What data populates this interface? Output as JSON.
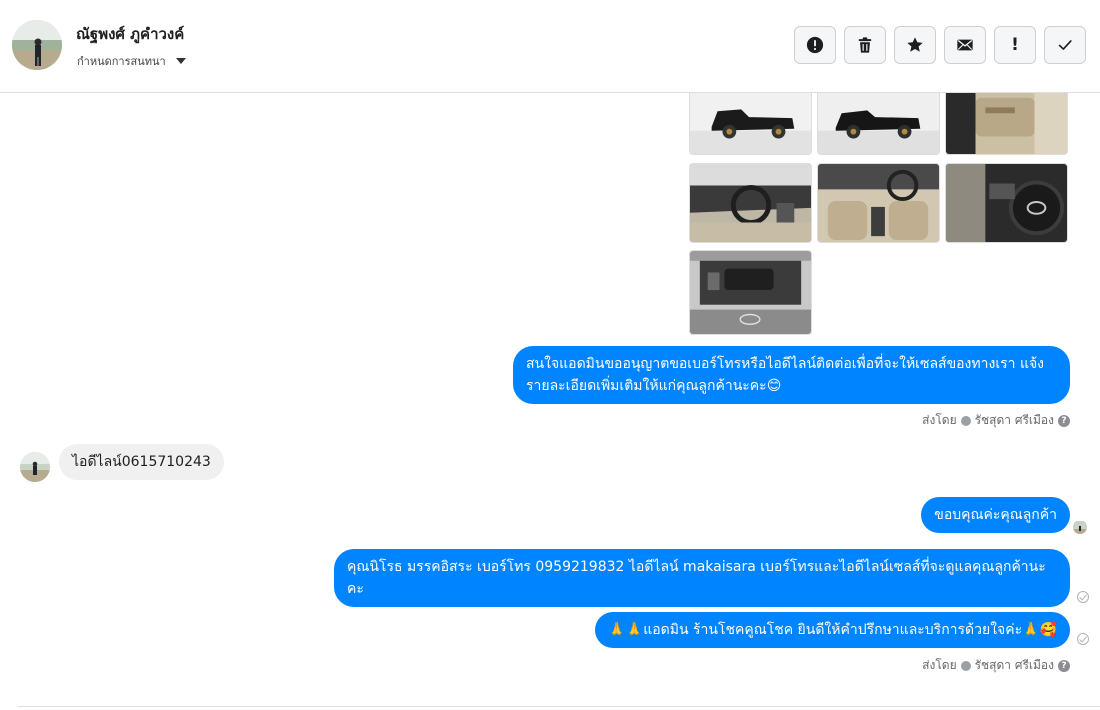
{
  "header": {
    "contact_name": "ณัฐพงศ์ ภูคำวงค์",
    "assign_label": "กำหนดการสนทนา",
    "actions": [
      {
        "name": "spam-button",
        "icon": "alert-circle-icon"
      },
      {
        "name": "delete-button",
        "icon": "trash-icon"
      },
      {
        "name": "star-button",
        "icon": "star-icon"
      },
      {
        "name": "mark-unread-button",
        "icon": "envelope-icon"
      },
      {
        "name": "follow-up-button",
        "icon": "exclamation-icon",
        "glyph": "!"
      },
      {
        "name": "mark-done-button",
        "icon": "checkmark-icon"
      }
    ]
  },
  "messages": {
    "admin_msg_1": "สนใจแอดมินขออนุญาตขอเบอร์โทรหรือไอดีไลน์ติดต่อเพื่อที่จะให้เซลส์ของทางเรา แจ้งรายละเอียดเพิ่มเติมให้แก่คุณลูกค้านะคะ😊",
    "sent_by_1": {
      "prefix": "ส่งโดย",
      "agent": "รัชสุดา ศรีเมือง",
      "help": "?"
    },
    "customer_msg": "ไอดีไลน์0615710243",
    "admin_msg_2": "ขอบคุณค่ะคุณลูกค้า",
    "admin_msg_3": "คุณนิโรธ มรรคอิสระ       เบอร์โทร 0959219832  ไอดีไลน์ makaisara   เบอร์โทรและไอดีไลน์เซลส์ที่จะดูแลคุณลูกค้านะคะ",
    "admin_msg_4": "🙏🙏แอดมิน ร้านโชคคูณโชค ยินดีให้คำปรึกษาและบริการด้วยใจค่ะ🙏🥰",
    "sent_by_2": {
      "prefix": "ส่งโดย",
      "agent": "รัชสุดา ศรีเมือง",
      "help": "?"
    }
  },
  "colors": {
    "bubble_out": "#0084ff",
    "bubble_in": "#f0f0f0",
    "border": "#dddfe2"
  },
  "photos": [
    {
      "name": "photo-truck-side-1",
      "subject": "black pickup truck side view"
    },
    {
      "name": "photo-truck-side-2",
      "subject": "black pickup truck side view"
    },
    {
      "name": "photo-door-interior",
      "subject": "door interior"
    },
    {
      "name": "photo-dashboard-1",
      "subject": "dashboard and steering wheel"
    },
    {
      "name": "photo-front-seats",
      "subject": "front seats interior"
    },
    {
      "name": "photo-steering-wheel",
      "subject": "steering wheel with logo"
    },
    {
      "name": "photo-engine-bay",
      "subject": "engine bay with open hood"
    }
  ]
}
